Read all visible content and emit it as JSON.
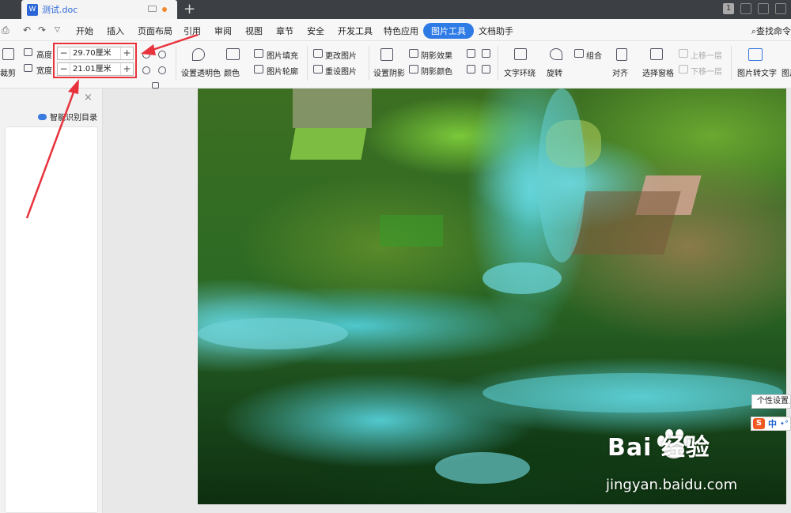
{
  "window": {
    "tab_title": "测试.doc",
    "tab_count_badge": "1"
  },
  "menubar": {
    "quick_file": "文件",
    "items": [
      "开始",
      "插入",
      "页面布局",
      "引用",
      "审阅",
      "视图",
      "章节",
      "安全",
      "开发工具",
      "特色应用",
      "图片工具",
      "文档助手"
    ],
    "active": "图片工具",
    "search_label": "查找命令"
  },
  "ribbon": {
    "crop": "裁剪",
    "height_label": "高度:",
    "width_label": "宽度:",
    "height_value": "29.70厘米",
    "width_value": "21.01厘米",
    "minus": "−",
    "plus": "+",
    "set_transparent": "设置透明色",
    "color": "颜色",
    "picture_fill": "图片填充",
    "picture_outline": "图片轮廓",
    "change_picture": "更改图片",
    "reset_picture": "重设图片",
    "set_shadow": "设置阴影",
    "shadow_effect": "阴影效果",
    "shadow_color": "阴影颜色",
    "text_wrap": "文字环绕",
    "rotate": "旋转",
    "group": "组合",
    "align": "对齐",
    "selection_pane": "选择窗格",
    "bring_forward": "上移一层",
    "send_backward": "下移一层",
    "picture_to_text": "图片转文字",
    "picture_more": "图片"
  },
  "left_panel": {
    "title": "智能识别目录",
    "close": "×"
  },
  "overlay": {
    "tooltip": "个性设置，",
    "ime_label": "中",
    "watermark_brand": "Bai 经验",
    "watermark_url": "jingyan.baidu.com"
  },
  "colors": {
    "accent": "#2e7be6",
    "annotation_red": "#e8323c",
    "toolbar_bg": "#f7f7f7"
  }
}
